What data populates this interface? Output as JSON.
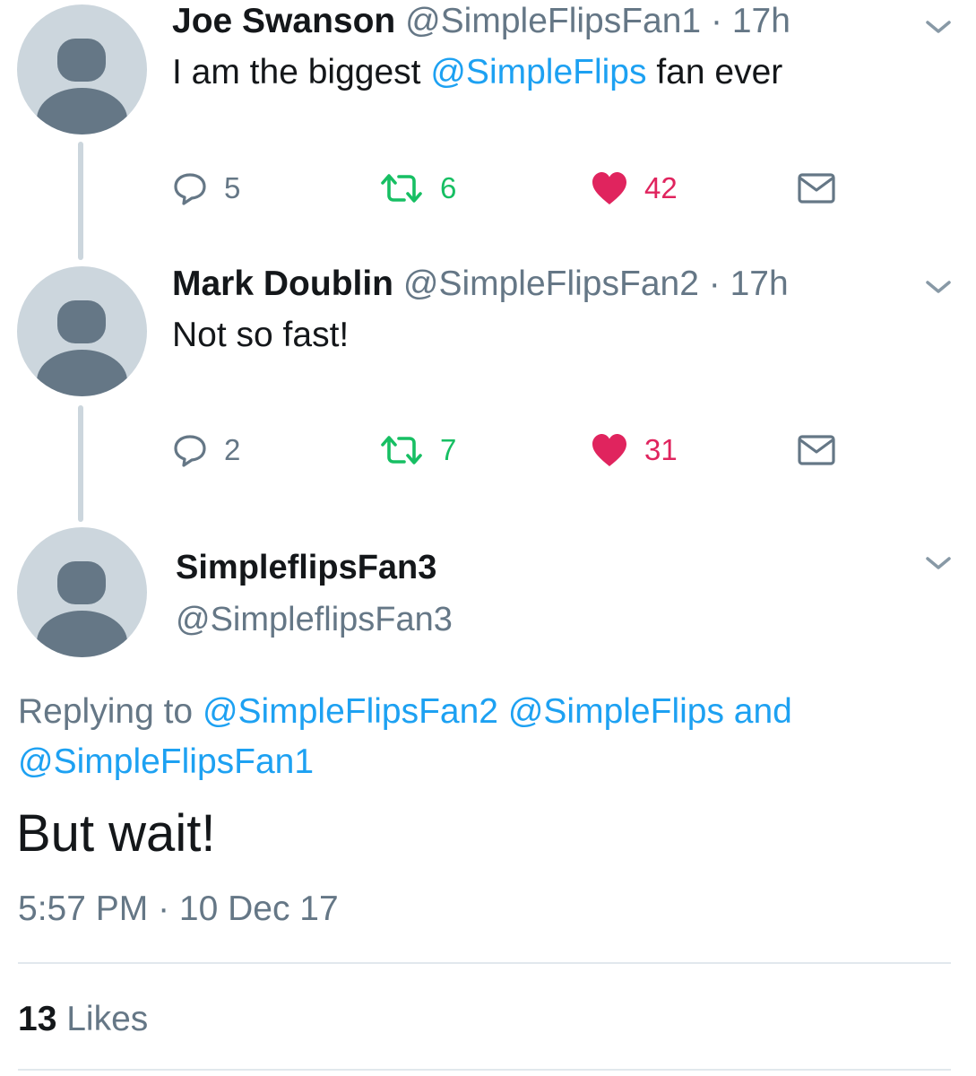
{
  "colors": {
    "mention": "#1da1f2",
    "muted": "#657786",
    "retweet": "#17bf63",
    "like": "#e0245e",
    "thread_line": "#ccd6dd",
    "avatar_bg": "#ccd6dd",
    "avatar_fg": "#657786"
  },
  "icons": {
    "reply": "reply-icon",
    "retweet": "retweet-icon",
    "like": "heart-icon",
    "message": "envelope-icon",
    "menu": "chevron-down-icon",
    "avatar": "default-avatar-icon"
  },
  "tweets": [
    {
      "name": "Joe Swanson",
      "handle": "@SimpleFlipsFan1",
      "sep": "·",
      "time": "17h",
      "text_prefix": "I am the biggest ",
      "text_mention": "@SimpleFlips",
      "text_suffix": " fan ever",
      "replies": "5",
      "retweets": "6",
      "likes": "42"
    },
    {
      "name": "Mark Doublin",
      "handle": "@SimpleFlipsFan2",
      "sep": "·",
      "time": "17h",
      "text": "Not so fast!",
      "replies": "2",
      "retweets": "7",
      "likes": "31"
    }
  ],
  "main_tweet": {
    "name": "SimpleflipsFan3",
    "handle": "@SimpleflipsFan3",
    "replying_label": "Replying to ",
    "replying_to": "@SimpleFlipsFan2 @SimpleFlips and @SimpleFlipsFan1",
    "text": "But wait!",
    "timestamp": "5:57 PM · 10 Dec 17",
    "likes_count": "13",
    "likes_label": "Likes"
  }
}
